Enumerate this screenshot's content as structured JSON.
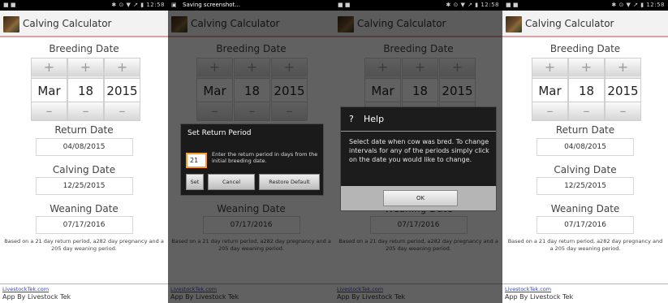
{
  "app": {
    "title": "Calving Calculator",
    "breeding_label": "Breeding Date",
    "return_label": "Return Date",
    "calving_label": "Calving Date",
    "weaning_label": "Weaning Date",
    "breeding": {
      "month": "Mar",
      "day": "18",
      "year": "2015"
    },
    "return_date": "04/08/2015",
    "calving_date": "12/25/2015",
    "weaning_date": "07/17/2016",
    "note": "Based on a 21 day return period, a282 day pregnancy and a 205 day weaning period.",
    "footer_link": "LivestockTek.com",
    "footer_by": "App By Livestock Tek",
    "plus": "+",
    "minus": "–"
  },
  "status": {
    "left": "■ ■",
    "right": "✱ ⊙ ▼ ↗ ▮ 12:58",
    "notification": "Saving screenshot..."
  },
  "return_dialog": {
    "title": "Set Return Period",
    "input_value": "21",
    "message": "Enter the return period in days from the initial breeding date.",
    "set_label": "Set",
    "cancel_label": "Cancel",
    "restore_label": "Restore Default"
  },
  "help_dialog": {
    "icon_text": "?",
    "title": "Help",
    "message": "Select date when cow was bred. To change intervals for any of the periods simply click on the date you would like to change.",
    "ok_label": "OK"
  }
}
